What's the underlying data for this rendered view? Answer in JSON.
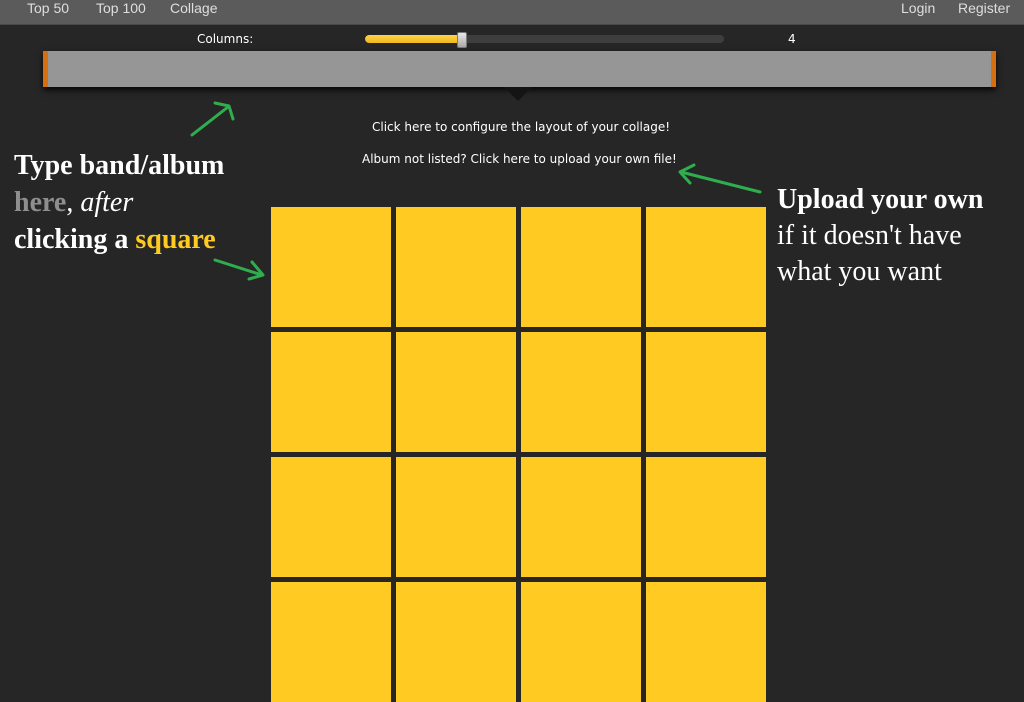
{
  "nav": {
    "left": [
      "Top 50",
      "Top 100",
      "Collage"
    ],
    "login": "Login",
    "register": "Register"
  },
  "layout_config": {
    "columns_label": "Columns:",
    "columns_value": "4",
    "columns_fraction": 0.27,
    "accent_color": "#ffca22"
  },
  "hints": {
    "configure": "Click here to configure the layout of your collage!",
    "upload": "Album not listed? Click here to upload your own file!"
  },
  "annotations": {
    "left": {
      "l1": "Type band/album",
      "l2_a": "here",
      "l2_b": ", ",
      "l2_c": "after",
      "l3_a": "clicking a ",
      "l3_b": "square"
    },
    "right": {
      "l1": "Upload your own",
      "l2": "if it doesn't have",
      "l3": "what you want"
    },
    "arrow_color": "#2fae4e"
  },
  "collage": {
    "columns": 4,
    "visible_cells": 16,
    "cell_color": "#ffca22"
  }
}
